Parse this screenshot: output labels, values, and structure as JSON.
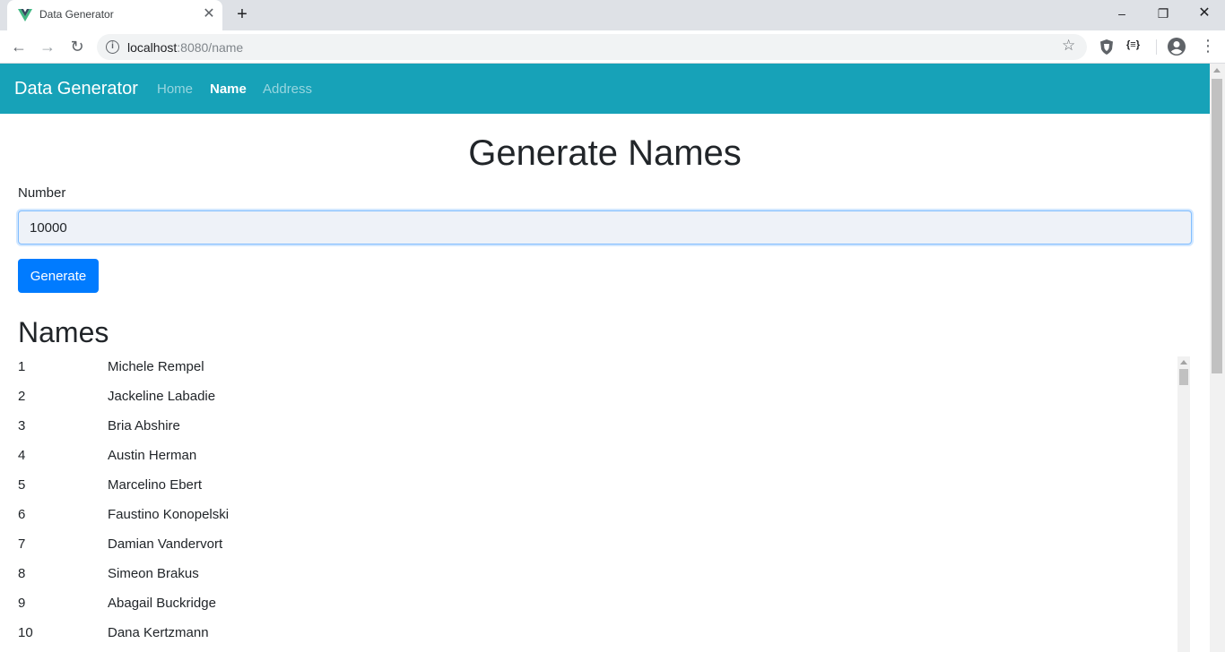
{
  "browser": {
    "tab_title": "Data Generator",
    "tab_icon": "vue-logo-icon",
    "url_host": "localhost",
    "url_path": ":8080/name",
    "window_controls": {
      "minimize": "–",
      "maximize": "❐",
      "close": "✕"
    }
  },
  "navbar": {
    "brand": "Data Generator",
    "links": [
      {
        "label": "Home",
        "active": false
      },
      {
        "label": "Name",
        "active": true
      },
      {
        "label": "Address",
        "active": false
      }
    ],
    "color": "#17a2b8"
  },
  "main": {
    "title": "Generate Names",
    "number_label": "Number",
    "number_value": "10000",
    "generate_label": "Generate",
    "names_heading": "Names",
    "names": [
      {
        "index": "1",
        "name": "Michele Rempel"
      },
      {
        "index": "2",
        "name": "Jackeline Labadie"
      },
      {
        "index": "3",
        "name": "Bria Abshire"
      },
      {
        "index": "4",
        "name": "Austin Herman"
      },
      {
        "index": "5",
        "name": "Marcelino Ebert"
      },
      {
        "index": "6",
        "name": "Faustino Konopelski"
      },
      {
        "index": "7",
        "name": "Damian Vandervort"
      },
      {
        "index": "8",
        "name": "Simeon Brakus"
      },
      {
        "index": "9",
        "name": "Abagail Buckridge"
      },
      {
        "index": "10",
        "name": "Dana Kertzmann"
      }
    ]
  },
  "colors": {
    "accent": "#17a2b8",
    "primary_button": "#007bff"
  }
}
